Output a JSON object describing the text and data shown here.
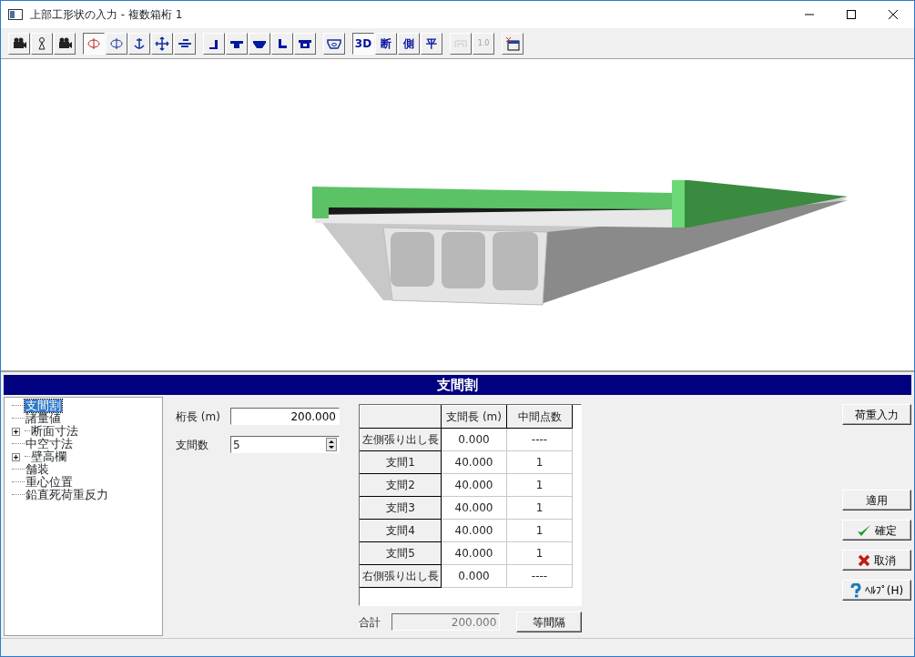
{
  "window": {
    "title": "上部工形状の入力 - 複数箱桁 1"
  },
  "toolbar": {
    "groups": [
      [
        {
          "kind": "icon",
          "selected": false,
          "disabled": false
        },
        {
          "kind": "icon",
          "selected": false,
          "disabled": false
        },
        {
          "kind": "icon",
          "selected": false,
          "disabled": false
        }
      ],
      [
        {
          "kind": "icon",
          "selected": true,
          "disabled": false
        },
        {
          "kind": "icon",
          "selected": false,
          "disabled": false
        },
        {
          "kind": "icon",
          "selected": false,
          "disabled": false
        },
        {
          "kind": "icon",
          "selected": false,
          "disabled": false
        },
        {
          "kind": "icon",
          "selected": false,
          "disabled": false
        }
      ],
      [
        {
          "kind": "icon",
          "selected": false,
          "disabled": false
        },
        {
          "kind": "icon",
          "selected": false,
          "disabled": false
        },
        {
          "kind": "icon",
          "selected": false,
          "disabled": false
        },
        {
          "kind": "icon",
          "selected": false,
          "disabled": false
        },
        {
          "kind": "icon",
          "selected": false,
          "disabled": false
        }
      ],
      [
        {
          "kind": "icon",
          "selected": false,
          "disabled": false
        }
      ],
      [
        {
          "kind": "text",
          "label": "3D",
          "selected": true,
          "disabled": false
        },
        {
          "kind": "text",
          "label": "断",
          "selected": false,
          "disabled": false
        },
        {
          "kind": "text",
          "label": "側",
          "selected": false,
          "disabled": false
        },
        {
          "kind": "text",
          "label": "平",
          "selected": false,
          "disabled": false
        }
      ],
      [
        {
          "kind": "icon",
          "selected": false,
          "disabled": true
        },
        {
          "kind": "text",
          "label": "1.0",
          "selected": false,
          "disabled": true
        }
      ],
      [
        {
          "kind": "icon",
          "selected": false,
          "disabled": false
        }
      ]
    ]
  },
  "panel": {
    "title": "支間割"
  },
  "tree": [
    {
      "label": "支間割",
      "selected": true
    },
    {
      "label": "諸量値",
      "selected": false
    },
    {
      "label": "断面寸法",
      "selected": false,
      "expanded": false
    },
    {
      "label": "中空寸法",
      "selected": false
    },
    {
      "label": "壁高欄",
      "selected": false,
      "expanded": false
    },
    {
      "label": "舗装",
      "selected": false
    },
    {
      "label": "重心位置",
      "selected": false
    },
    {
      "label": "鉛直死荷重反力",
      "selected": false
    }
  ],
  "fields": [
    {
      "kind": "text",
      "label": "桁長 (m)",
      "value": "200.000"
    },
    {
      "kind": "spinner",
      "label": "支間数",
      "value": "5"
    }
  ],
  "table": {
    "columns": [
      "支間長 (m)",
      "中間点数"
    ],
    "rows": [
      {
        "header": "左側張り出し長",
        "cells": [
          "0.000",
          "----"
        ]
      },
      {
        "header": "支間1",
        "cells": [
          "40.000",
          "1"
        ]
      },
      {
        "header": "支間2",
        "cells": [
          "40.000",
          "1"
        ]
      },
      {
        "header": "支間3",
        "cells": [
          "40.000",
          "1"
        ]
      },
      {
        "header": "支間4",
        "cells": [
          "40.000",
          "1"
        ]
      },
      {
        "header": "支間5",
        "cells": [
          "40.000",
          "1"
        ]
      },
      {
        "header": "右側張り出し長",
        "cells": [
          "0.000",
          "----"
        ]
      }
    ]
  },
  "total": {
    "label": "合計",
    "value": "200.000",
    "disabled": true
  },
  "equal_button": "等間隔",
  "side_buttons": [
    {
      "kind": "plain",
      "label": "荷重入力"
    },
    {
      "kind": "plain",
      "label": "適用"
    },
    {
      "kind": "ok",
      "label": "確定"
    },
    {
      "kind": "cancel",
      "label": "取消"
    },
    {
      "kind": "help",
      "label": "ﾍﾙﾌﾟ(H)"
    }
  ]
}
